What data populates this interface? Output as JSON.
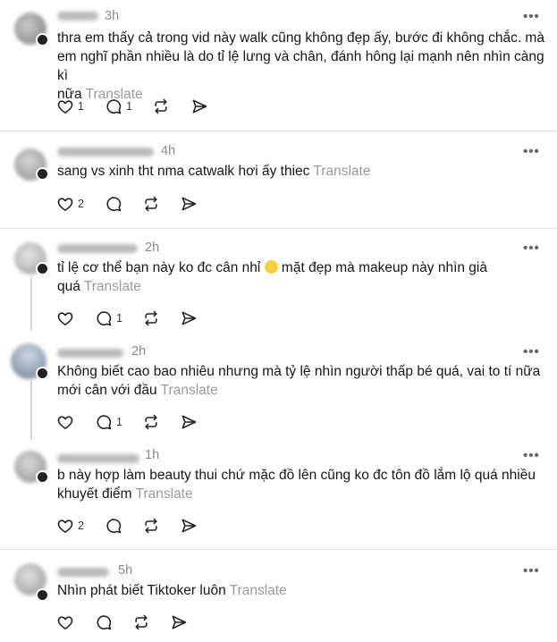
{
  "translate_label": "Translate",
  "more_label": "•••",
  "comments": [
    {
      "user": "_____",
      "time": "3h",
      "lines": [
        "thra em thấy cả trong vid này walk cũng không đẹp ấy, bước đi không chắc. mà",
        "em nghĩ phần nhiều là do tỉ lệ lưng và chân, đánh hông lại mạnh nên nhìn càng kì",
        "nữa"
      ],
      "likes": "1",
      "replies": "1"
    },
    {
      "user": "_____",
      "time": "4h",
      "lines": [
        "sang vs xinh tht nma catwalk hơi ấy thiec"
      ],
      "likes": "2",
      "replies": ""
    },
    {
      "user": "_____",
      "time": "2h",
      "lines": [
        "tỉ lệ cơ thể bạn này ko đc cân nhỉ",
        "quá"
      ],
      "emoji_after": " mặt đẹp mà makeup này nhìn già",
      "likes": "",
      "replies": "1"
    },
    {
      "user": "_____",
      "time": "2h",
      "lines": [
        "Không biết cao bao nhiêu nhưng mà tỷ lệ nhìn người thấp bé quá, vai to tí nữa",
        "mới cân với đầu"
      ],
      "likes": "",
      "replies": "1"
    },
    {
      "user": "_____",
      "time": "1h",
      "lines": [
        "b này hợp làm beauty thui chứ mặc đồ lên cũng ko đc tôn đồ lắm lộ quá nhiều",
        "khuyết điểm"
      ],
      "likes": "2",
      "replies": ""
    },
    {
      "user": "_____",
      "time": "5h",
      "lines": [
        "Nhìn phát biết Tiktoker luôn"
      ],
      "likes": "",
      "replies": ""
    }
  ]
}
